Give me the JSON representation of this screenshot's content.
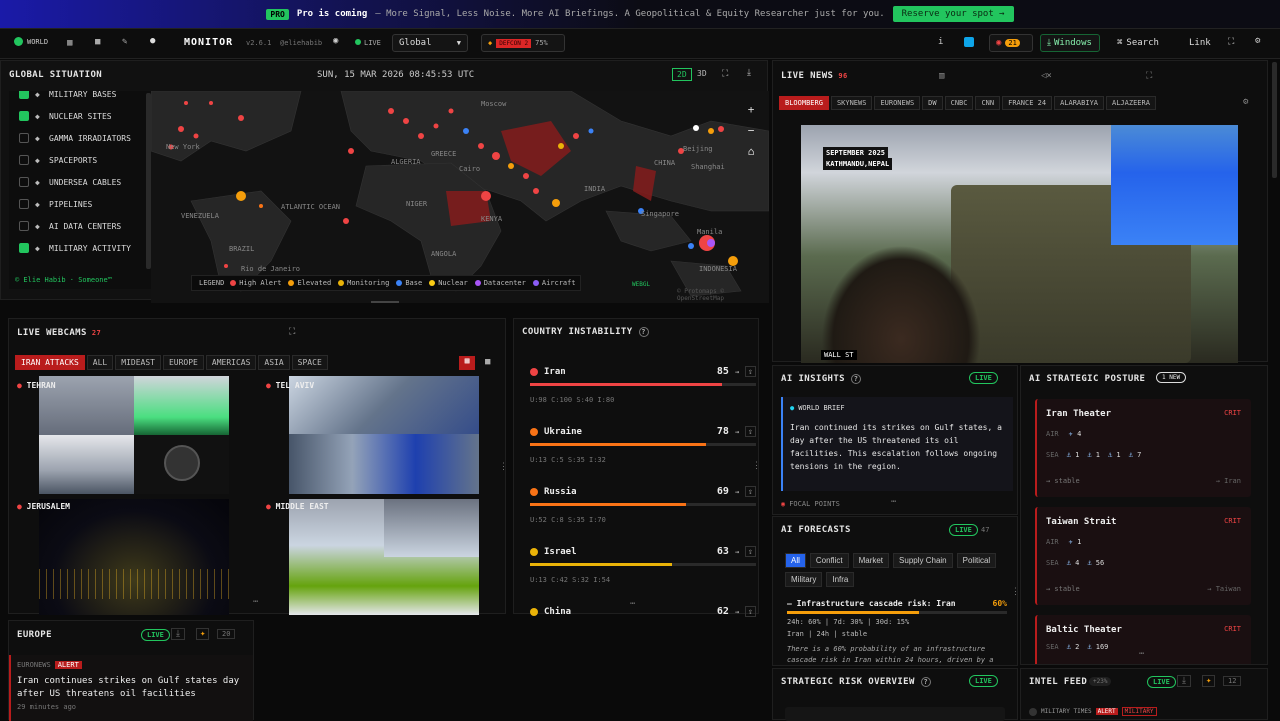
{
  "banner": {
    "pro": "PRO",
    "headline": "Pro is coming",
    "message": "— More Signal, Less Noise. More AI Briefings. A Geopolitical & Equity Researcher just for you.",
    "cta": "Reserve your spot →"
  },
  "topbar": {
    "world": "WORLD",
    "app_title": "MONITOR",
    "version": "v2.6.1",
    "handle": "@eliehabib",
    "live": "LIVE",
    "region": "Global",
    "defcon": "DEFCON 2",
    "defcon_pct": "75%",
    "notif_count": "21",
    "windows": "Windows",
    "search": "Search",
    "link": "Link"
  },
  "map": {
    "title": "GLOBAL SITUATION",
    "datetime": "SUN, 15 MAR 2026 08:45:53 UTC",
    "mode2d": "2D",
    "mode3d": "3D",
    "credit": "© Elie Habib · Someone™",
    "webgl": "WEBGL",
    "attribution": "© Protomaps © OpenStreetMap",
    "layers": [
      {
        "label": "MILITARY BASES",
        "checked": true
      },
      {
        "label": "NUCLEAR SITES",
        "checked": true
      },
      {
        "label": "GAMMA IRRADIATORS",
        "checked": false
      },
      {
        "label": "SPACEPORTS",
        "checked": false
      },
      {
        "label": "UNDERSEA CABLES",
        "checked": false
      },
      {
        "label": "PIPELINES",
        "checked": false
      },
      {
        "label": "AI DATA CENTERS",
        "checked": false
      },
      {
        "label": "MILITARY ACTIVITY",
        "checked": true
      }
    ],
    "legend_title": "LEGEND",
    "legend": [
      {
        "label": "High Alert",
        "color": "#ef4444"
      },
      {
        "label": "Elevated",
        "color": "#f59e0b"
      },
      {
        "label": "Monitoring",
        "color": "#eab308"
      },
      {
        "label": "Base",
        "color": "#3b82f6"
      },
      {
        "label": "Nuclear",
        "color": "#facc15"
      },
      {
        "label": "Datacenter",
        "color": "#a855f7"
      },
      {
        "label": "Aircraft",
        "color": "#8b5cf6"
      }
    ],
    "places": [
      "Moscow",
      "New York",
      "Cairo",
      "Beijing",
      "Shanghai",
      "INDIA",
      "CHINA",
      "Singapore",
      "Manila",
      "BRAZIL",
      "Rio de Janeiro",
      "VENEZUELA",
      "KENYA",
      "INDONESIA",
      "GREECE",
      "ALGERIA",
      "NIGER",
      "ANGOLA",
      "ATLANTIC OCEAN"
    ]
  },
  "webcams": {
    "title": "LIVE WEBCAMS",
    "count": "27",
    "tabs": [
      "IRAN ATTACKS",
      "ALL",
      "MIDEAST",
      "EUROPE",
      "AMERICAS",
      "ASIA",
      "SPACE"
    ],
    "cams": [
      "TEHRAN",
      "TEL AVIV",
      "JERUSALEM",
      "MIDDLE EAST"
    ]
  },
  "instability": {
    "title": "COUNTRY INSTABILITY",
    "rows": [
      {
        "country": "Iran",
        "score": "85",
        "arrow": "→",
        "stats": "U:98  C:100  S:40  I:80",
        "level": 0.85,
        "color": "#ef4444"
      },
      {
        "country": "Ukraine",
        "score": "78",
        "arrow": "→",
        "stats": "U:13  C:5  S:35  I:32",
        "level": 0.78,
        "color": "#f97316"
      },
      {
        "country": "Russia",
        "score": "69",
        "arrow": "→",
        "stats": "U:52  C:8  S:35  I:70",
        "level": 0.69,
        "color": "#f97316"
      },
      {
        "country": "Israel",
        "score": "63",
        "arrow": "→",
        "stats": "U:13  C:42  S:32  I:54",
        "level": 0.63,
        "color": "#eab308"
      },
      {
        "country": "China",
        "score": "62",
        "arrow": "→"
      }
    ]
  },
  "news": {
    "title": "LIVE NEWS",
    "count": "96",
    "channels": [
      "BLOOMBERG",
      "SKYNEWS",
      "EURONEWS",
      "DW",
      "CNBC",
      "CNN",
      "FRANCE 24",
      "ALARABIYA",
      "ALJAZEERA"
    ],
    "overlay_date": "SEPTEMBER 2025",
    "overlay_place": "KATHMANDU,NEPAL",
    "ticker": "WALL ST"
  },
  "insights": {
    "title": "AI INSIGHTS",
    "live": "LIVE",
    "section": "WORLD BRIEF",
    "text": "Iran continued its strikes on Gulf states, a day after the US threatened its oil facilities. This escalation follows ongoing tensions in the region.",
    "focal": "FOCAL POINTS"
  },
  "posture": {
    "title": "AI STRATEGIC POSTURE",
    "badge": "1 NEW",
    "theaters": [
      {
        "name": "Iran Theater",
        "level": "CRIT",
        "air": "4",
        "sea": [
          "1",
          "1",
          "1",
          "7"
        ],
        "trend": "→ stable",
        "region": "→ Iran"
      },
      {
        "name": "Taiwan Strait",
        "level": "CRIT",
        "air": "1",
        "sea": [
          "4",
          "56"
        ],
        "trend": "→ stable",
        "region": "→ Taiwan"
      },
      {
        "name": "Baltic Theater",
        "level": "CRIT",
        "sea": [
          "2",
          "169"
        ]
      }
    ]
  },
  "forecasts": {
    "title": "AI FORECASTS",
    "live": "LIVE",
    "count": "47",
    "filters": [
      "All",
      "Conflict",
      "Market",
      "Supply Chain",
      "Political",
      "Military",
      "Infra"
    ],
    "item": {
      "title": "— Infrastructure cascade risk: Iran",
      "pct": "60%",
      "range": "24h: 60%  |  7d: 30%  |  30d: 15%",
      "meta": "Iran | 24h | stable",
      "text": "There is a 60% probability of an infrastructure cascade risk in Iran within 24 hours, driven by a"
    }
  },
  "europe": {
    "title": "EUROPE",
    "live": "LIVE",
    "count": "20",
    "source": "EURONEWS",
    "tag": "ALERT",
    "headline": "Iran continues strikes on Gulf states day after US threatens oil facilities",
    "time": "29 minutes ago"
  },
  "risk": {
    "title": "STRATEGIC RISK OVERVIEW",
    "live": "LIVE"
  },
  "intel": {
    "title": "INTEL FEED",
    "badge": "+23%",
    "live": "LIVE",
    "count": "12",
    "source": "MILITARY TIMES",
    "tag1": "ALERT",
    "tag2": "MILITARY"
  },
  "colors": {
    "accent": "#22c55e",
    "alert": "#ef4444",
    "warn": "#f59e0b"
  }
}
